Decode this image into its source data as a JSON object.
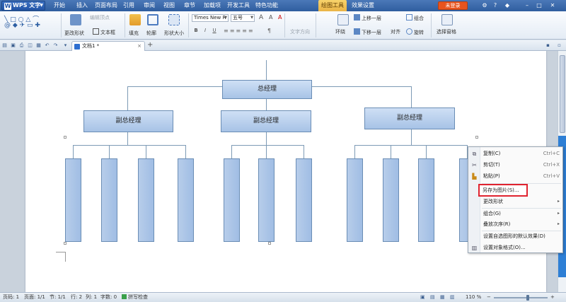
{
  "app": {
    "title": "WPS 文字",
    "login_label": "未登录"
  },
  "menu": {
    "items": [
      "开始",
      "插入",
      "页面布局",
      "引用",
      "审阅",
      "视图",
      "章节",
      "加载项",
      "开发工具",
      "特色功能",
      "绘图工具",
      "效果设置"
    ]
  },
  "ribbon": {
    "edit_vertex": "编辑顶点",
    "change_shape": "更改形状",
    "text_box": "文本框",
    "fill": "填充",
    "outline": "轮廓",
    "shape_size": "形状大小",
    "font_name": "Times New R",
    "font_size": "五号",
    "text_direction": "文字方向",
    "wrap": "环绕",
    "bring_forward": "上移一层",
    "send_backward": "下移一层",
    "align": "对齐",
    "group": "组合",
    "rotate": "旋转",
    "selection_pane": "选择窗格",
    "format_buttons": [
      "B",
      "I",
      "U"
    ]
  },
  "tabs": {
    "doc_title": "文档1 *"
  },
  "chart": {
    "top": "总经理",
    "deputies": [
      "副总经理",
      "副总经理",
      "副总经理"
    ]
  },
  "context_menu": {
    "items": [
      {
        "label": "复制(C)",
        "shortcut": "Ctrl+C",
        "icon": "copy-icon"
      },
      {
        "label": "剪切(T)",
        "shortcut": "Ctrl+X",
        "icon": "cut-icon"
      },
      {
        "label": "粘贴(P)",
        "shortcut": "Ctrl+V",
        "icon": "paste-icon"
      },
      {
        "label": "另存为图片(S)...",
        "shortcut": "",
        "icon": ""
      },
      {
        "label": "更改形状",
        "shortcut": "",
        "icon": ""
      },
      {
        "label": "组合(G)",
        "shortcut": "",
        "icon": ""
      },
      {
        "label": "叠放次序(R)",
        "shortcut": "",
        "icon": ""
      },
      {
        "label": "设置自选图形的默认效果(D)",
        "shortcut": "",
        "icon": ""
      },
      {
        "label": "设置对象格式(O)...",
        "shortcut": "",
        "icon": "format-icon"
      }
    ]
  },
  "status": {
    "page": "页码: 1",
    "pages": "页面: 1/1",
    "section": "节: 1/1",
    "line": "行: 2",
    "column": "列: 1",
    "words": "字数: 0",
    "spell": "拼写检查",
    "zoom": "110 %"
  },
  "colors": {
    "titlebar": "#2f5e9f",
    "highlight_border": "#e0232f",
    "login": "#e8541e"
  }
}
